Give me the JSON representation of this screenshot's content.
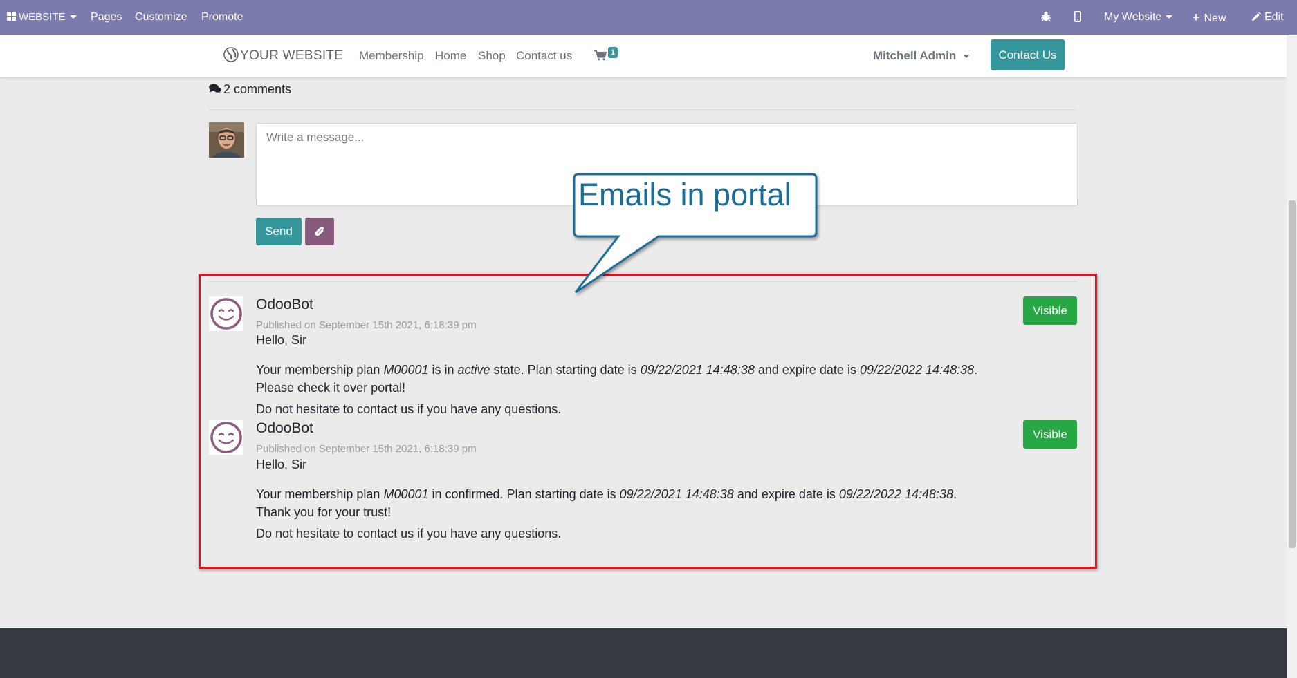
{
  "admin_bar": {
    "website_label": "WEBSITE",
    "pages_label": "Pages",
    "customize_label": "Customize",
    "promote_label": "Promote",
    "debug_icon": "bug-icon",
    "mobile_icon": "mobile-icon",
    "site_selector": "My Website",
    "new_label": "New",
    "edit_label": "Edit"
  },
  "header": {
    "logo_text": "YOUR WEBSITE",
    "nav": [
      "Membership",
      "Home",
      "Shop",
      "Contact us"
    ],
    "cart_count": "1",
    "user_name": "Mitchell Admin",
    "contact_button": "Contact Us"
  },
  "comments": {
    "count_label": "2 comments",
    "message_placeholder": "Write a message...",
    "send_label": "Send",
    "attach_icon": "paperclip-icon"
  },
  "callout": {
    "text": "Emails in portal"
  },
  "messages": [
    {
      "author": "OdooBot",
      "published": "Published on September 15th 2021, 6:18:39 pm",
      "greeting": "Hello, Sir",
      "plan_prefix": "Your membership plan ",
      "plan_code": "M00001",
      "state_prefix": " is in ",
      "state": "active",
      "state_suffix": " state. Plan starting date is ",
      "start_date": "09/22/2021 14:48:38",
      "expire_prefix": " and expire date is ",
      "expire_date": "09/22/2022 14:48:38",
      "end": ".",
      "line2": "Please check it over portal!",
      "closing": "Do not hesitate to contact us if you have any questions.",
      "visibility": "Visible"
    },
    {
      "author": "OdooBot",
      "published": "Published on September 15th 2021, 6:18:39 pm",
      "greeting": "Hello, Sir",
      "plan_prefix": "Your membership plan ",
      "plan_code": "M00001",
      "state_text": " in confirmed. Plan starting date is ",
      "start_date": "09/22/2021 14:48:38",
      "expire_prefix": " and expire date is ",
      "expire_date": "09/22/2022 14:48:38",
      "end": ".",
      "line2": "Thank you for your trust!",
      "closing": "Do not hesitate to contact us if you have any questions.",
      "visibility": "Visible"
    }
  ],
  "colors": {
    "admin_bar": "#7c7bad",
    "primary": "#35979c",
    "secondary": "#875a7b",
    "success": "#28a745",
    "highlight": "#d9141e",
    "callout_border": "#1b6d9a",
    "footer": "#343a40"
  }
}
